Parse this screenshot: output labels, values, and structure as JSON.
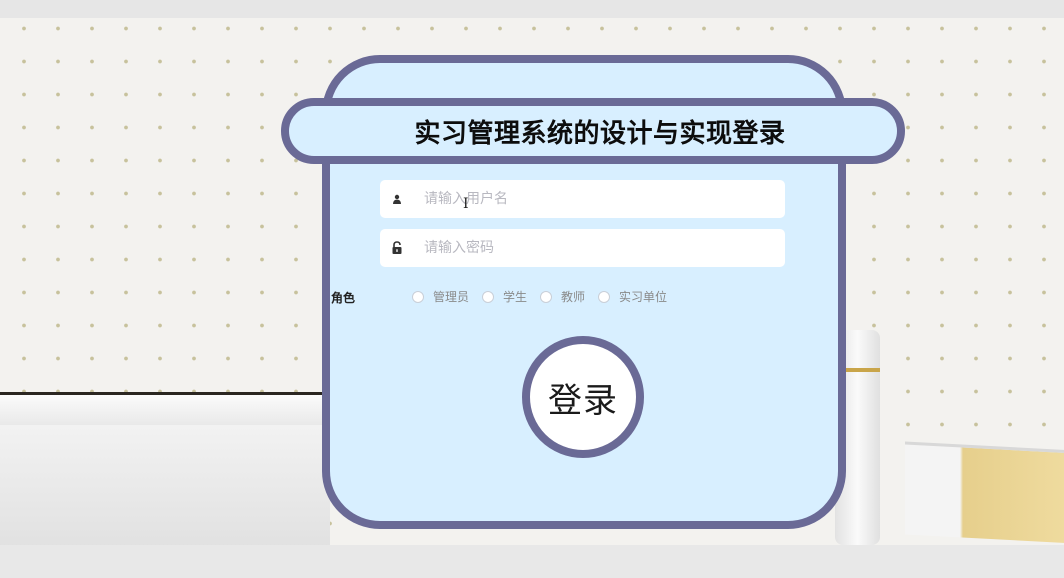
{
  "page": {
    "title": "实习管理系统的设计与实现登录",
    "accent_color": "#6a6a96",
    "card_color": "#d8efff"
  },
  "form": {
    "username_placeholder": "请输入用户名",
    "username_icon": "user-icon",
    "password_placeholder": "请输入密码",
    "password_icon": "lock-icon",
    "role_label": "角色",
    "roles": [
      "管理员",
      "学生",
      "教师",
      "实习单位"
    ],
    "login_label": "登录"
  }
}
